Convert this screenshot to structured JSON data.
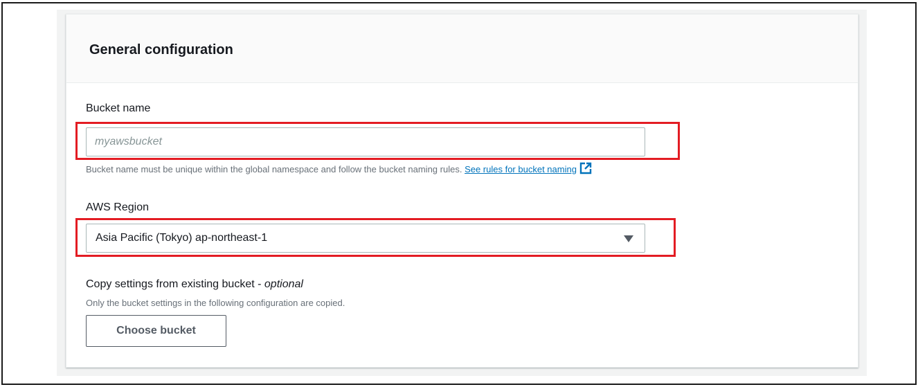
{
  "section": {
    "title": "General configuration"
  },
  "bucket_name": {
    "label": "Bucket name",
    "placeholder": "myawsbucket",
    "hint": "Bucket name must be unique within the global namespace and follow the bucket naming rules.",
    "link_text": "See rules for bucket naming",
    "link_icon": "external-link-icon"
  },
  "region": {
    "label": "AWS Region",
    "selected": "Asia Pacific (Tokyo) ap-northeast-1"
  },
  "copy_settings": {
    "label": "Copy settings from existing bucket - ",
    "label_optional": "optional",
    "hint": "Only the bucket settings in the following configuration are copied.",
    "button_label": "Choose bucket"
  },
  "colors": {
    "highlight": "#e31c23",
    "link": "#0073bb"
  }
}
